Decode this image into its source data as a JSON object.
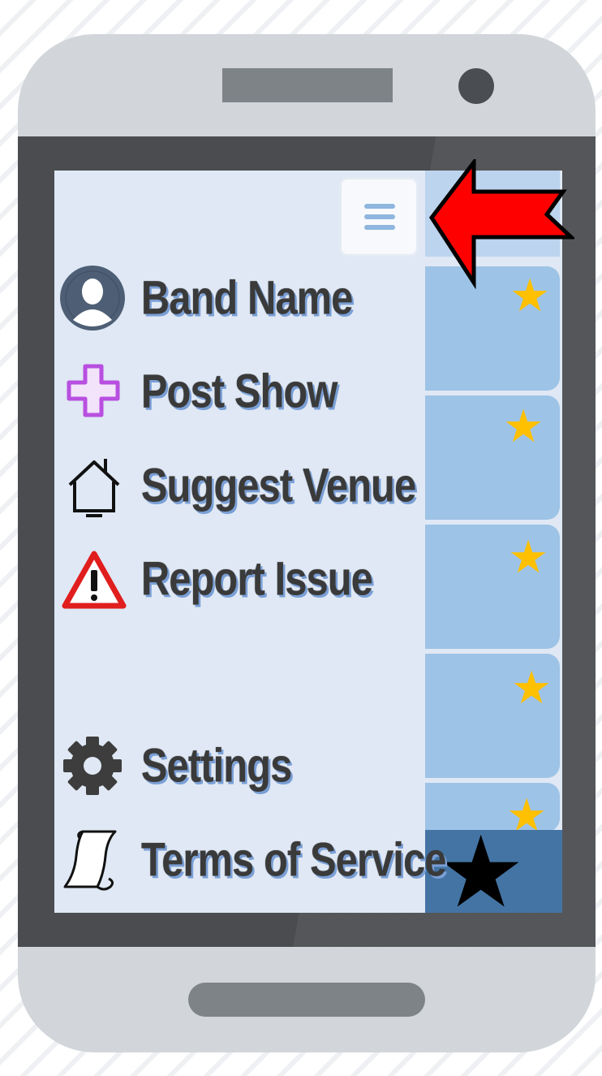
{
  "menu": {
    "items": [
      {
        "label": "Band Name",
        "icon": "profile-avatar-icon"
      },
      {
        "label": "Post Show",
        "icon": "plus-icon"
      },
      {
        "label": "Suggest Venue",
        "icon": "house-icon"
      },
      {
        "label": "Report Issue",
        "icon": "warning-icon"
      },
      {
        "label": "Settings",
        "icon": "gear-icon"
      },
      {
        "label": "Terms of Service",
        "icon": "scroll-icon"
      }
    ]
  },
  "header": {
    "menu_icon": "hamburger-menu-icon"
  },
  "cards": [
    {
      "icon": "star-icon"
    },
    {
      "icon": "star-icon"
    },
    {
      "icon": "star-icon"
    },
    {
      "icon": "star-icon"
    },
    {
      "icon": "star-icon"
    }
  ],
  "glyphs": {
    "star": "★"
  },
  "colors": {
    "screen": "#dfe8f4",
    "card": "#9dc3e6",
    "star": "#ffc000",
    "bottom_tile": "#4474a4",
    "arrow": "#ff0000",
    "label_shadow": "#7a9fd6"
  }
}
